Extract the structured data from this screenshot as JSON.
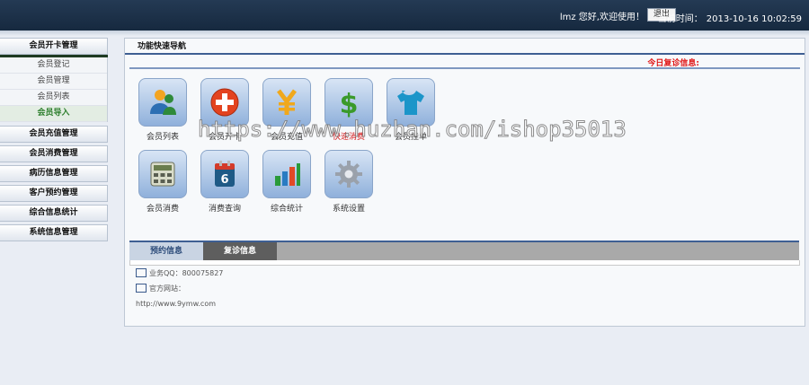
{
  "header": {
    "greeting": "lmz 您好,欢迎使用！",
    "logout_label": "退出",
    "time_label": "当前时间：",
    "time_value": "2013-10-16 10:02:59"
  },
  "sidebar": {
    "open_group": "会员开卡管理",
    "sub_items": [
      "会员登记",
      "会员管理",
      "会员列表",
      "会员导入"
    ],
    "groups": [
      "会员充值管理",
      "会员消费管理",
      "病历信息管理",
      "客户预约管理",
      "综合信息统计",
      "系统信息管理"
    ]
  },
  "panel": {
    "title": "功能快速导航",
    "notice": "今日复诊信息:",
    "tiles": [
      {
        "label": "会员列表",
        "icon": "user-icon"
      },
      {
        "label": "会员开卡",
        "icon": "plus-icon"
      },
      {
        "label": "会员充值",
        "icon": "yen-icon"
      },
      {
        "label": "快速消费",
        "icon": "dollar-icon"
      },
      {
        "label": "会员挂单",
        "icon": "shirt-icon"
      },
      {
        "label": "会员消费",
        "icon": "calculator-icon"
      },
      {
        "label": "消费查询",
        "icon": "calendar-icon"
      },
      {
        "label": "综合统计",
        "icon": "bar-chart-icon"
      },
      {
        "label": "系统设置",
        "icon": "gear-icon"
      }
    ],
    "tab_1": "预约信息",
    "tab_2": "复诊信息",
    "qq": "业务QQ：800075827",
    "site_label": "官方网站：",
    "site_url": "http://www.9ymw.com"
  },
  "watermark": "https://www.huzhan.com/ishop35013",
  "colors": {
    "accent_blue": "#3e5f93",
    "notice_red": "#e01515",
    "active_green": "#2a7d2a"
  }
}
